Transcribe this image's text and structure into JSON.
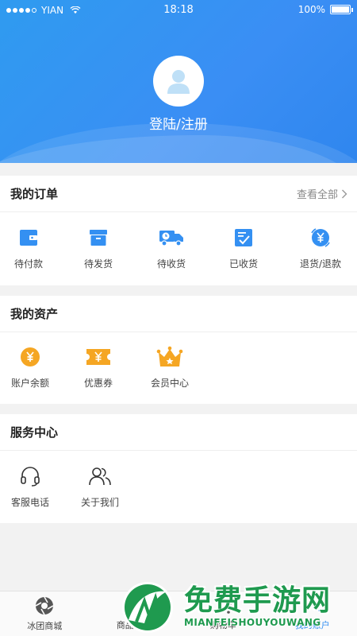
{
  "status_bar": {
    "carrier": "YIAN",
    "time": "18:18",
    "battery": "100%"
  },
  "profile": {
    "login_label": "登陆/注册"
  },
  "orders": {
    "title": "我的订单",
    "view_all": "查看全部",
    "items": [
      {
        "label": "待付款",
        "icon": "wallet-icon"
      },
      {
        "label": "待发货",
        "icon": "package-box-icon"
      },
      {
        "label": "待收货",
        "icon": "delivery-truck-icon"
      },
      {
        "label": "已收货",
        "icon": "received-check-icon"
      },
      {
        "label": "退货/退款",
        "icon": "refund-yen-icon"
      }
    ]
  },
  "assets": {
    "title": "我的资产",
    "items": [
      {
        "label": "账户余额",
        "icon": "yen-coin-icon"
      },
      {
        "label": "优惠券",
        "icon": "coupon-icon"
      },
      {
        "label": "会员中心",
        "icon": "crown-icon"
      }
    ]
  },
  "services": {
    "title": "服务中心",
    "items": [
      {
        "label": "客服电话",
        "icon": "headset-icon"
      },
      {
        "label": "关于我们",
        "icon": "people-icon"
      }
    ]
  },
  "tabbar": {
    "items": [
      {
        "label": "冰团商城",
        "icon": "shutter-logo-icon"
      },
      {
        "label": "商品分类",
        "icon": "category-icon"
      },
      {
        "label": "购物车",
        "icon": "cart-icon"
      },
      {
        "label": "我的账户",
        "icon": "account-icon"
      }
    ]
  },
  "watermark": {
    "title": "免费手游网",
    "subtitle": "MIANFEISHOUYOUWANG"
  },
  "colors": {
    "brand_blue": "#3490f2",
    "accent_orange": "#f5a623",
    "watermark_green": "#1f9a4f"
  }
}
